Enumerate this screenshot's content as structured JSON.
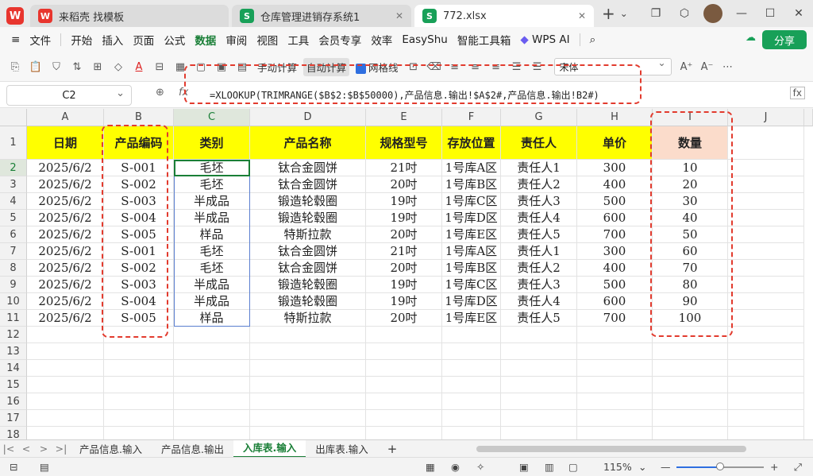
{
  "titlebar": {
    "tabs": [
      {
        "label": "来稻壳 找模板",
        "icon": "wps-docer-icon"
      },
      {
        "label": "仓库管理进销存系统1",
        "icon": "spreadsheet-icon"
      },
      {
        "label": "772.xlsx",
        "icon": "spreadsheet-icon"
      }
    ],
    "new_tab": "+",
    "spreadsheet_glyph": "S",
    "docer_glyph": "W"
  },
  "menu": {
    "items": [
      "文件",
      "开始",
      "插入",
      "页面",
      "公式",
      "数据",
      "审阅",
      "视图",
      "工具",
      "会员专享",
      "效率",
      "EasyShu",
      "智能工具箱",
      "WPS AI"
    ],
    "active": "数据",
    "share": "分享"
  },
  "toolbar": {
    "manual_calc": "手动计算",
    "auto_calc": "自动计算",
    "gridlines": "网格线",
    "font": "宋体"
  },
  "formula_bar": {
    "cell_ref": "C2",
    "fx": "fx",
    "formula": "=XLOOKUP(TRIMRANGE($B$2:$B$50000),产品信息.输出!$A$2#,产品信息.输出!B2#)"
  },
  "grid": {
    "columns": [
      "A",
      "B",
      "C",
      "D",
      "E",
      "F",
      "G",
      "H",
      "I",
      "J"
    ],
    "rows": [
      "1",
      "2",
      "3",
      "4",
      "5",
      "6",
      "7",
      "8",
      "9",
      "10",
      "11",
      "12",
      "13",
      "14",
      "15",
      "16",
      "17",
      "18"
    ],
    "headers": [
      "日期",
      "产品编码",
      "类别",
      "产品名称",
      "规格型号",
      "存放位置",
      "责任人",
      "单价",
      "数量"
    ],
    "data": [
      [
        "2025/6/2",
        "S-001",
        "毛坯",
        "钛合金圆饼",
        "21吋",
        "1号库A区",
        "责任人1",
        "300",
        "10"
      ],
      [
        "2025/6/2",
        "S-002",
        "毛坯",
        "钛合金圆饼",
        "20吋",
        "1号库B区",
        "责任人2",
        "400",
        "20"
      ],
      [
        "2025/6/2",
        "S-003",
        "半成品",
        "锻造轮毂圈",
        "19吋",
        "1号库C区",
        "责任人3",
        "500",
        "30"
      ],
      [
        "2025/6/2",
        "S-004",
        "半成品",
        "锻造轮毂圈",
        "19吋",
        "1号库D区",
        "责任人4",
        "600",
        "40"
      ],
      [
        "2025/6/2",
        "S-005",
        "样品",
        "特斯拉款",
        "20吋",
        "1号库E区",
        "责任人5",
        "700",
        "50"
      ],
      [
        "2025/6/2",
        "S-001",
        "毛坯",
        "钛合金圆饼",
        "21吋",
        "1号库A区",
        "责任人1",
        "300",
        "60"
      ],
      [
        "2025/6/2",
        "S-002",
        "毛坯",
        "钛合金圆饼",
        "20吋",
        "1号库B区",
        "责任人2",
        "400",
        "70"
      ],
      [
        "2025/6/2",
        "S-003",
        "半成品",
        "锻造轮毂圈",
        "19吋",
        "1号库C区",
        "责任人3",
        "500",
        "80"
      ],
      [
        "2025/6/2",
        "S-004",
        "半成品",
        "锻造轮毂圈",
        "19吋",
        "1号库D区",
        "责任人4",
        "600",
        "90"
      ],
      [
        "2025/6/2",
        "S-005",
        "样品",
        "特斯拉款",
        "20吋",
        "1号库E区",
        "责任人5",
        "700",
        "100"
      ]
    ]
  },
  "sheets": {
    "tabs": [
      "产品信息.输入",
      "产品信息.输出",
      "入库表.输入",
      "出库表.输入"
    ],
    "active": "入库表.输入",
    "add": "+"
  },
  "status": {
    "zoom": "115%",
    "zoom_fraction": 0.5
  },
  "colors": {
    "accent": "#1a7f37",
    "header_fill": "#ffff00",
    "peach_fill": "#fbdccb",
    "annotation": "#e23b2e"
  }
}
